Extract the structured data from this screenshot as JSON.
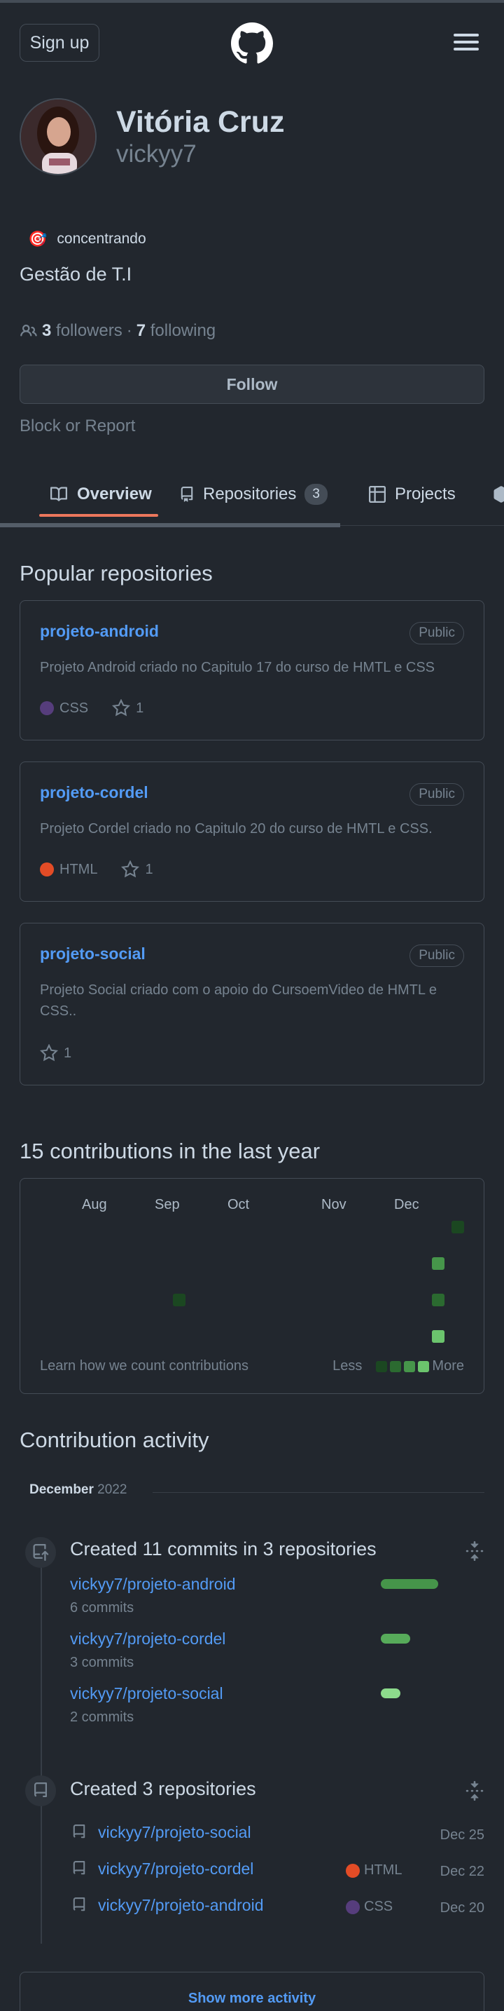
{
  "header": {
    "signup_label": "Sign up",
    "logo_icon": "github-mark-icon",
    "menu_icon": "hamburger-menu-icon"
  },
  "profile": {
    "name": "Vitória Cruz",
    "login": "vickyy7",
    "status_emoji": "🎯",
    "status_text": "concentrando",
    "bio": "Gestão de T.I",
    "followers_count": "3",
    "followers_label": "followers",
    "separator": "·",
    "following_count": "7",
    "following_label": "following",
    "follow_label": "Follow",
    "block_label": "Block or Report"
  },
  "tabs": [
    {
      "label": "Overview",
      "icon": "book-icon",
      "active": true
    },
    {
      "label": "Repositories",
      "icon": "repo-icon",
      "count": "3"
    },
    {
      "label": "Projects",
      "icon": "table-icon"
    },
    {
      "label": "",
      "icon": "package-icon"
    }
  ],
  "popular": {
    "title": "Popular repositories",
    "repos": [
      {
        "name": "projeto-android",
        "visibility": "Public",
        "description": "Projeto Android criado no Capitulo 17 do curso de HMTL e CSS",
        "language": "CSS",
        "language_color": "#563d7c",
        "stars": "1"
      },
      {
        "name": "projeto-cordel",
        "visibility": "Public",
        "description": "Projeto Cordel criado no Capitulo 20 do curso de HMTL e CSS.",
        "language": "HTML",
        "language_color": "#e34c26",
        "stars": "1"
      },
      {
        "name": "projeto-social",
        "visibility": "Public",
        "description": "Projeto Social criado com o apoio do CursoemVideo de HMTL e CSS..",
        "language": "",
        "stars": "1"
      }
    ]
  },
  "contributions": {
    "title": "15 contributions in the last year",
    "months": [
      "Aug",
      "Sep",
      "Oct",
      "Nov",
      "Dec"
    ],
    "learn_label": "Learn how we count contributions",
    "less_label": "Less",
    "more_label": "More",
    "level_colors": [
      "#1b4721",
      "#2b6a30",
      "#46954a",
      "#6bc46d"
    ]
  },
  "activity": {
    "title": "Contribution activity",
    "month": "December",
    "year": "2022",
    "commits_title": "Created 11 commits in 3 repositories",
    "commit_repos": [
      {
        "repo": "vickyy7/projeto-android",
        "count": "6 commits",
        "share": 0.55
      },
      {
        "repo": "vickyy7/projeto-cordel",
        "count": "3 commits",
        "share": 0.27
      },
      {
        "repo": "vickyy7/projeto-social",
        "count": "2 commits",
        "share": 0.18
      }
    ],
    "repos_title": "Created 3 repositories",
    "new_repos": [
      {
        "repo": "vickyy7/projeto-social",
        "language": "",
        "date": "Dec 25"
      },
      {
        "repo": "vickyy7/projeto-cordel",
        "language": "HTML",
        "language_color": "#e34c26",
        "date": "Dec 22"
      },
      {
        "repo": "vickyy7/projeto-android",
        "language": "CSS",
        "language_color": "#563d7c",
        "date": "Dec 20"
      }
    ],
    "show_more_label": "Show more activity"
  }
}
